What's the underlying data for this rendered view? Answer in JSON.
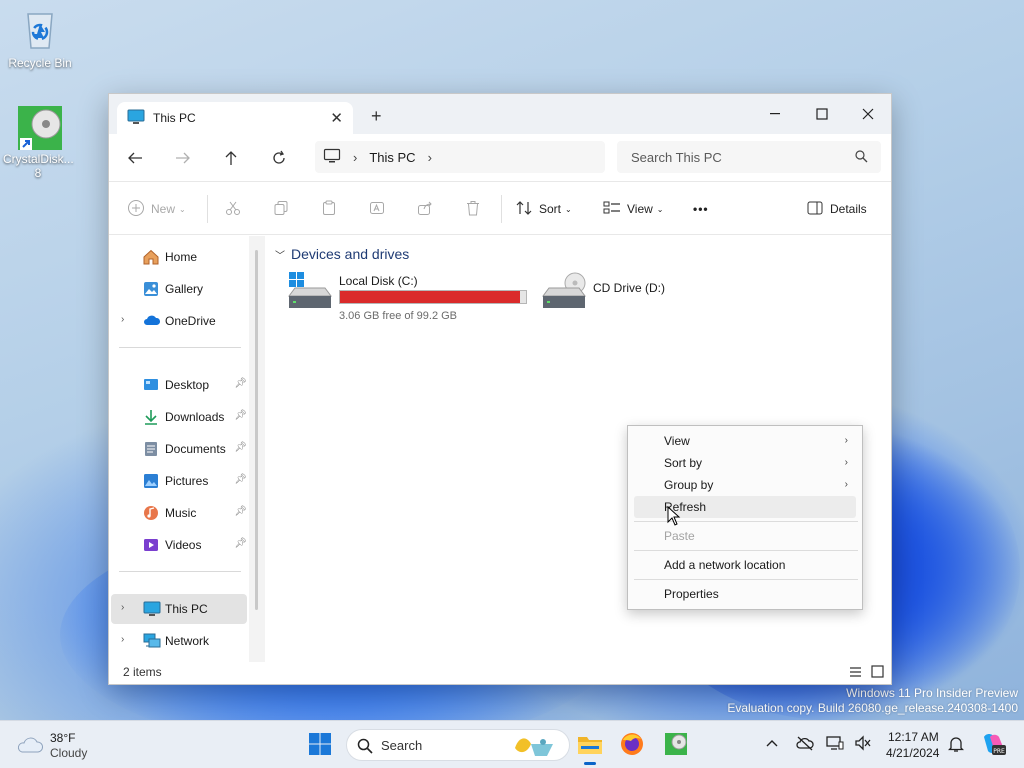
{
  "desktop": {
    "icons": [
      {
        "label": "Recycle Bin"
      },
      {
        "label": "CrystalDisk... 8"
      }
    ],
    "watermark": {
      "line1": "Windows 11 Pro Insider Preview",
      "line2": "Evaluation copy. Build 26080.ge_release.240308-1400"
    }
  },
  "window": {
    "tab_title": "This PC",
    "address": {
      "location": "This PC",
      "search_placeholder": "Search This PC"
    },
    "toolbar": {
      "new_label": "New",
      "sort_label": "Sort",
      "view_label": "View",
      "more_label": "•••",
      "details_label": "Details"
    },
    "sidebar": {
      "items": [
        {
          "label": "Home"
        },
        {
          "label": "Gallery"
        },
        {
          "label": "OneDrive"
        },
        {
          "label": "Desktop"
        },
        {
          "label": "Downloads"
        },
        {
          "label": "Documents"
        },
        {
          "label": "Pictures"
        },
        {
          "label": "Music"
        },
        {
          "label": "Videos"
        },
        {
          "label": "This PC"
        },
        {
          "label": "Network"
        }
      ]
    },
    "content": {
      "group_title": "Devices and drives",
      "drives": [
        {
          "name": "Local Disk (C:)",
          "free_text": "3.06 GB free of 99.2 GB",
          "used_fraction": 0.969
        },
        {
          "name": "CD Drive (D:)"
        }
      ]
    },
    "status": {
      "items_count": "2 items"
    }
  },
  "context_menu": {
    "items": [
      {
        "label": "View"
      },
      {
        "label": "Sort by"
      },
      {
        "label": "Group by"
      },
      {
        "label": "Refresh"
      },
      {
        "label": "Paste"
      },
      {
        "label": "Add a network location"
      },
      {
        "label": "Properties"
      }
    ]
  },
  "taskbar": {
    "weather": {
      "temp": "38°F",
      "condition": "Cloudy"
    },
    "search_label": "Search",
    "clock": {
      "time": "12:17 AM",
      "date": "4/21/2024"
    }
  },
  "colors": {
    "accent": "#0a64c8",
    "disk_bar_full": "#da2a2a",
    "group_header": "#1f3b74"
  }
}
